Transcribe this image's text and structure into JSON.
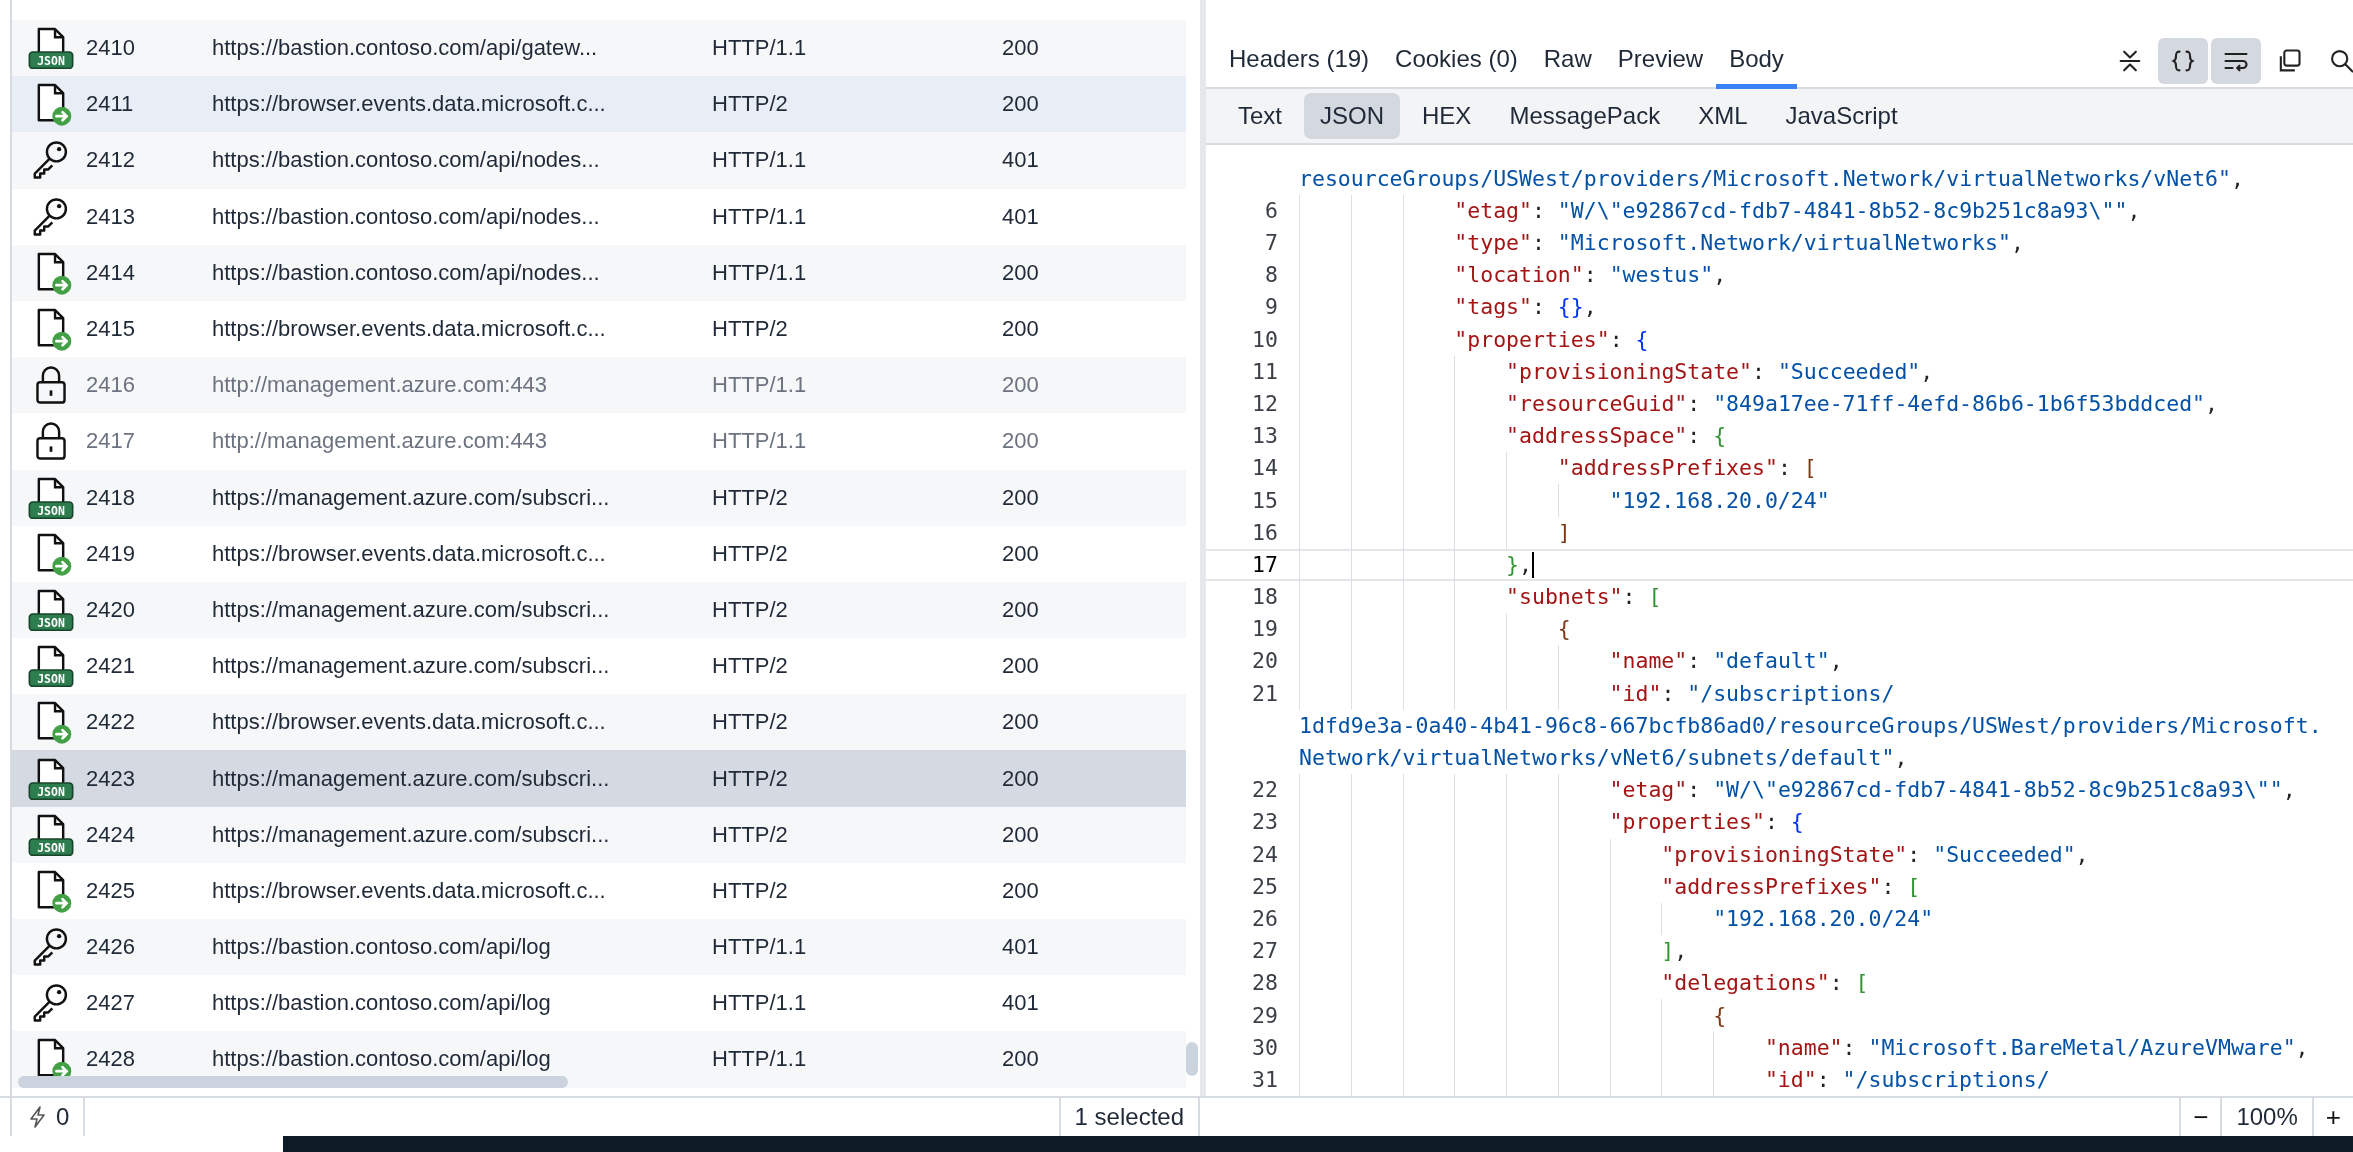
{
  "requests": {
    "rows": [
      {
        "kind": "json",
        "badge": "JSON",
        "id": "2410",
        "url": "https://bastion.contoso.com/api/gatew...",
        "protocol": "HTTP/1.1",
        "status": "200",
        "selected": false,
        "hovered": false,
        "dimmed": false
      },
      {
        "kind": "file",
        "id": "2411",
        "url": "https://browser.events.data.microsoft.c...",
        "protocol": "HTTP/2",
        "status": "200",
        "selected": false,
        "hovered": true,
        "dimmed": false
      },
      {
        "kind": "key",
        "id": "2412",
        "url": "https://bastion.contoso.com/api/nodes...",
        "protocol": "HTTP/1.1",
        "status": "401",
        "selected": false,
        "hovered": false,
        "dimmed": false
      },
      {
        "kind": "key",
        "id": "2413",
        "url": "https://bastion.contoso.com/api/nodes...",
        "protocol": "HTTP/1.1",
        "status": "401",
        "selected": false,
        "hovered": false,
        "dimmed": false
      },
      {
        "kind": "file",
        "id": "2414",
        "url": "https://bastion.contoso.com/api/nodes...",
        "protocol": "HTTP/1.1",
        "status": "200",
        "selected": false,
        "hovered": false,
        "dimmed": false
      },
      {
        "kind": "file",
        "id": "2415",
        "url": "https://browser.events.data.microsoft.c...",
        "protocol": "HTTP/2",
        "status": "200",
        "selected": false,
        "hovered": false,
        "dimmed": false
      },
      {
        "kind": "lock",
        "id": "2416",
        "url": "http://management.azure.com:443",
        "protocol": "HTTP/1.1",
        "status": "200",
        "selected": false,
        "hovered": false,
        "dimmed": true
      },
      {
        "kind": "lock",
        "id": "2417",
        "url": "http://management.azure.com:443",
        "protocol": "HTTP/1.1",
        "status": "200",
        "selected": false,
        "hovered": false,
        "dimmed": true
      },
      {
        "kind": "json",
        "badge": "JSON",
        "id": "2418",
        "url": "https://management.azure.com/subscri...",
        "protocol": "HTTP/2",
        "status": "200",
        "selected": false,
        "hovered": false,
        "dimmed": false
      },
      {
        "kind": "file",
        "id": "2419",
        "url": "https://browser.events.data.microsoft.c...",
        "protocol": "HTTP/2",
        "status": "200",
        "selected": false,
        "hovered": false,
        "dimmed": false
      },
      {
        "kind": "json",
        "badge": "JSON",
        "id": "2420",
        "url": "https://management.azure.com/subscri...",
        "protocol": "HTTP/2",
        "status": "200",
        "selected": false,
        "hovered": false,
        "dimmed": false
      },
      {
        "kind": "json",
        "badge": "JSON",
        "id": "2421",
        "url": "https://management.azure.com/subscri...",
        "protocol": "HTTP/2",
        "status": "200",
        "selected": false,
        "hovered": false,
        "dimmed": false
      },
      {
        "kind": "file",
        "id": "2422",
        "url": "https://browser.events.data.microsoft.c...",
        "protocol": "HTTP/2",
        "status": "200",
        "selected": false,
        "hovered": false,
        "dimmed": false
      },
      {
        "kind": "json",
        "badge": "JSON",
        "id": "2423",
        "url": "https://management.azure.com/subscri...",
        "protocol": "HTTP/2",
        "status": "200",
        "selected": true,
        "hovered": false,
        "dimmed": false
      },
      {
        "kind": "json",
        "badge": "JSON",
        "id": "2424",
        "url": "https://management.azure.com/subscri...",
        "protocol": "HTTP/2",
        "status": "200",
        "selected": false,
        "hovered": false,
        "dimmed": false
      },
      {
        "kind": "file",
        "id": "2425",
        "url": "https://browser.events.data.microsoft.c...",
        "protocol": "HTTP/2",
        "status": "200",
        "selected": false,
        "hovered": false,
        "dimmed": false
      },
      {
        "kind": "key",
        "id": "2426",
        "url": "https://bastion.contoso.com/api/log",
        "protocol": "HTTP/1.1",
        "status": "401",
        "selected": false,
        "hovered": false,
        "dimmed": false
      },
      {
        "kind": "key",
        "id": "2427",
        "url": "https://bastion.contoso.com/api/log",
        "protocol": "HTTP/1.1",
        "status": "401",
        "selected": false,
        "hovered": false,
        "dimmed": false
      },
      {
        "kind": "file",
        "id": "2428",
        "url": "https://bastion.contoso.com/api/log",
        "protocol": "HTTP/1.1",
        "status": "200",
        "selected": false,
        "hovered": false,
        "dimmed": false
      }
    ]
  },
  "response": {
    "tabs": [
      {
        "label": "Headers (19)",
        "selected": false
      },
      {
        "label": "Cookies (0)",
        "selected": false
      },
      {
        "label": "Raw",
        "selected": false
      },
      {
        "label": "Preview",
        "selected": false
      },
      {
        "label": "Body",
        "selected": true
      }
    ],
    "tools": [
      {
        "kind": "collapse",
        "on": false
      },
      {
        "kind": "format",
        "on": true
      },
      {
        "kind": "wrap",
        "on": true
      },
      {
        "kind": "copy",
        "on": false
      },
      {
        "kind": "search",
        "on": false
      }
    ],
    "formats": [
      {
        "label": "Text",
        "selected": false
      },
      {
        "label": "JSON",
        "selected": true
      },
      {
        "label": "HEX",
        "selected": false
      },
      {
        "label": "MessagePack",
        "selected": false
      },
      {
        "label": "XML",
        "selected": false
      },
      {
        "label": "JavaScript",
        "selected": false
      }
    ],
    "code_lines": [
      {
        "continued": true,
        "current": false,
        "text": "resourceGroups/USWest/providers/Microsoft.Network/virtualNetworks/vNet6\","
      },
      {
        "number": "6",
        "continued": false,
        "current": false,
        "text": "            \"etag\": \"W/\\\"e92867cd-fdb7-4841-8b52-8c9b251c8a93\\\"\","
      },
      {
        "number": "7",
        "continued": false,
        "current": false,
        "text": "            \"type\": \"Microsoft.Network/virtualNetworks\","
      },
      {
        "number": "8",
        "continued": false,
        "current": false,
        "text": "            \"location\": \"westus\","
      },
      {
        "number": "9",
        "continued": false,
        "current": false,
        "text": "            \"tags\": {},"
      },
      {
        "number": "10",
        "continued": false,
        "current": false,
        "text": "            \"properties\": {"
      },
      {
        "number": "11",
        "continued": false,
        "current": false,
        "text": "                \"provisioningState\": \"Succeeded\","
      },
      {
        "number": "12",
        "continued": false,
        "current": false,
        "text": "                \"resourceGuid\": \"849a17ee-71ff-4efd-86b6-1b6f53bddced\","
      },
      {
        "number": "13",
        "continued": false,
        "current": false,
        "text": "                \"addressSpace\": {"
      },
      {
        "number": "14",
        "continued": false,
        "current": false,
        "text": "                    \"addressPrefixes\": ["
      },
      {
        "number": "15",
        "continued": false,
        "current": false,
        "text": "                        \"192.168.20.0/24\""
      },
      {
        "number": "16",
        "continued": false,
        "current": false,
        "text": "                    ]"
      },
      {
        "number": "17",
        "continued": false,
        "current": true,
        "text": "                },"
      },
      {
        "number": "18",
        "continued": false,
        "current": false,
        "text": "                \"subnets\": ["
      },
      {
        "number": "19",
        "continued": false,
        "current": false,
        "text": "                    {"
      },
      {
        "number": "20",
        "continued": false,
        "current": false,
        "text": "                        \"name\": \"default\","
      },
      {
        "number": "21",
        "continued": false,
        "current": false,
        "text": "                        \"id\": \"/subscriptions/"
      },
      {
        "continued": true,
        "current": false,
        "text": "1dfd9e3a-0a40-4b41-96c8-667bcfb86ad0/resourceGroups/USWest/providers/Microsoft."
      },
      {
        "continued": true,
        "current": false,
        "text": "Network/virtualNetworks/vNet6/subnets/default\","
      },
      {
        "number": "22",
        "continued": false,
        "current": false,
        "text": "                        \"etag\": \"W/\\\"e92867cd-fdb7-4841-8b52-8c9b251c8a93\\\"\","
      },
      {
        "number": "23",
        "continued": false,
        "current": false,
        "text": "                        \"properties\": {"
      },
      {
        "number": "24",
        "continued": false,
        "current": false,
        "text": "                            \"provisioningState\": \"Succeeded\","
      },
      {
        "number": "25",
        "continued": false,
        "current": false,
        "text": "                            \"addressPrefixes\": ["
      },
      {
        "number": "26",
        "continued": false,
        "current": false,
        "text": "                                \"192.168.20.0/24\""
      },
      {
        "number": "27",
        "continued": false,
        "current": false,
        "text": "                            ],"
      },
      {
        "number": "28",
        "continued": false,
        "current": false,
        "text": "                            \"delegations\": ["
      },
      {
        "number": "29",
        "continued": false,
        "current": false,
        "text": "                                {"
      },
      {
        "number": "30",
        "continued": false,
        "current": false,
        "text": "                                    \"name\": \"Microsoft.BareMetal/AzureVMware\","
      },
      {
        "number": "31",
        "continued": false,
        "current": false,
        "text": "                                    \"id\": \"/subscriptions/"
      }
    ]
  },
  "status_bar": {
    "count": "0",
    "selection": "1 selected",
    "zoom_out": "−",
    "zoom": "100%",
    "zoom_in": "+"
  }
}
